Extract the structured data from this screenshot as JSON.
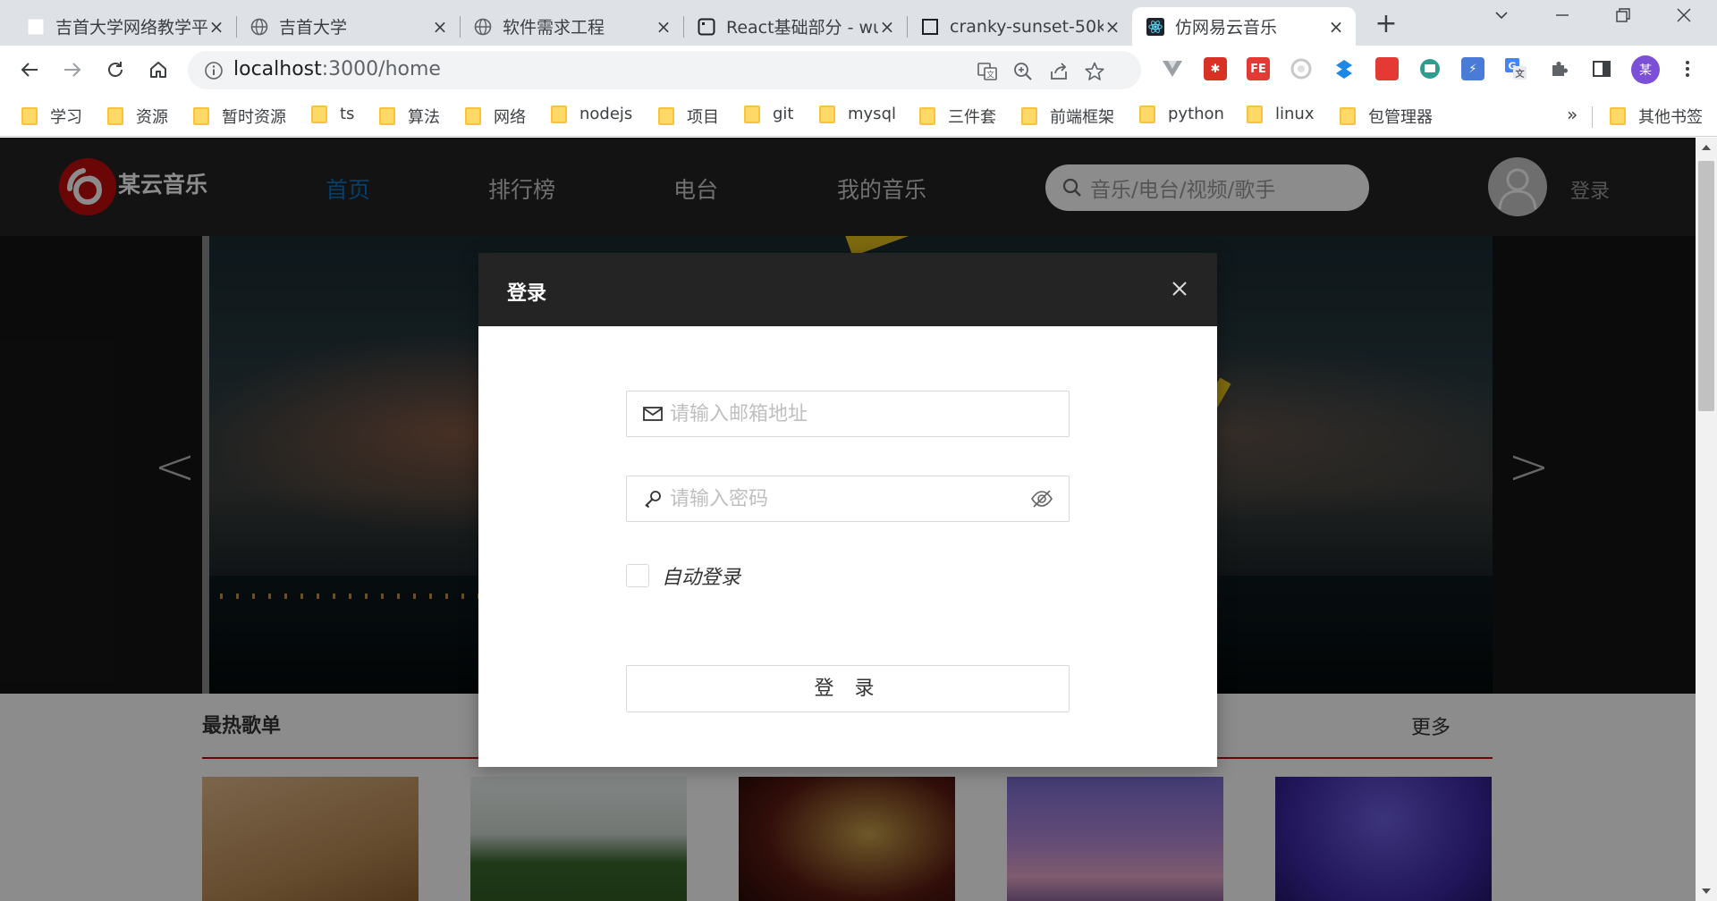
{
  "browser": {
    "tabs": [
      {
        "title": "吉首大学网络教学平台",
        "favicon": "blank-page-icon",
        "active": false
      },
      {
        "title": "吉首大学",
        "favicon": "globe-icon",
        "active": false
      },
      {
        "title": "软件需求工程",
        "favicon": "globe-icon",
        "active": false
      },
      {
        "title": "React基础部分 - wuwu",
        "favicon": "terminal-icon",
        "active": false
      },
      {
        "title": "cranky-sunset-50k",
        "favicon": "square-icon",
        "active": false
      },
      {
        "title": "仿网易云音乐",
        "favicon": "react-icon",
        "active": true
      }
    ],
    "url_host": "localhost",
    "url_path": ":3000/home",
    "profile_initial": "某",
    "bookmarks": [
      "学习",
      "资源",
      "暂时资源",
      "ts",
      "算法",
      "网络",
      "nodejs",
      "项目",
      "git",
      "mysql",
      "三件套",
      "前端框架",
      "python",
      "linux",
      "包管理器"
    ],
    "bookmarks_more": "»",
    "other_bookmarks": "其他书签"
  },
  "site": {
    "logo_text": "某云音乐",
    "nav": [
      "首页",
      "排行榜",
      "电台",
      "我的音乐"
    ],
    "active_nav": 0,
    "search_placeholder": "音乐/电台/视频/歌手",
    "login_text": "登录",
    "banner_prev": "<",
    "banner_next": ">",
    "section_title": "最热歌单",
    "section_more": "更多"
  },
  "modal": {
    "title": "登录",
    "email_placeholder": "请输入邮箱地址",
    "password_placeholder": "请输入密码",
    "auto_login": "自动登录",
    "submit": "登 录"
  },
  "colors": {
    "accent": "#0c73c2",
    "brand_red": "#c20c0c",
    "header_bg": "#242424"
  }
}
